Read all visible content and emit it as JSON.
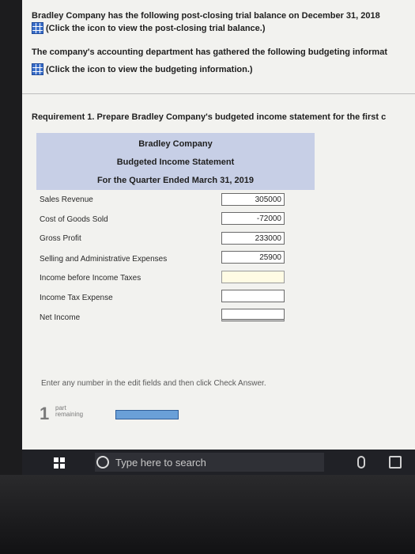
{
  "question": {
    "line1": "Bradley Company has the following post-closing trial balance on December 31, 2018",
    "link1": "(Click the icon to view the post-closing trial balance.)",
    "line2": "The company's accounting department has gathered the following budgeting informat",
    "link2": "(Click the icon to view the budgeting information.)"
  },
  "requirement": "Requirement 1. Prepare Bradley Company's budgeted income statement for the first c",
  "statement": {
    "company": "Bradley Company",
    "title": "Budgeted Income Statement",
    "period": "For the Quarter Ended March 31, 2019",
    "rows": [
      {
        "label": "Sales Revenue",
        "value": "305000"
      },
      {
        "label": "Cost of Goods Sold",
        "value": "-72000"
      },
      {
        "label": "Gross Profit",
        "value": "233000"
      },
      {
        "label": "Selling and Administrative Expenses",
        "value": "25900"
      },
      {
        "label": "Income before Income Taxes",
        "value": ""
      },
      {
        "label": "Income Tax Expense",
        "value": ""
      },
      {
        "label": "Net Income",
        "value": ""
      }
    ]
  },
  "hint": "Enter any number in the edit fields and then click Check Answer.",
  "progress": {
    "count": "1",
    "text_line1": "part",
    "text_line2": "remaining"
  },
  "taskbar": {
    "search_placeholder": "Type here to search"
  }
}
